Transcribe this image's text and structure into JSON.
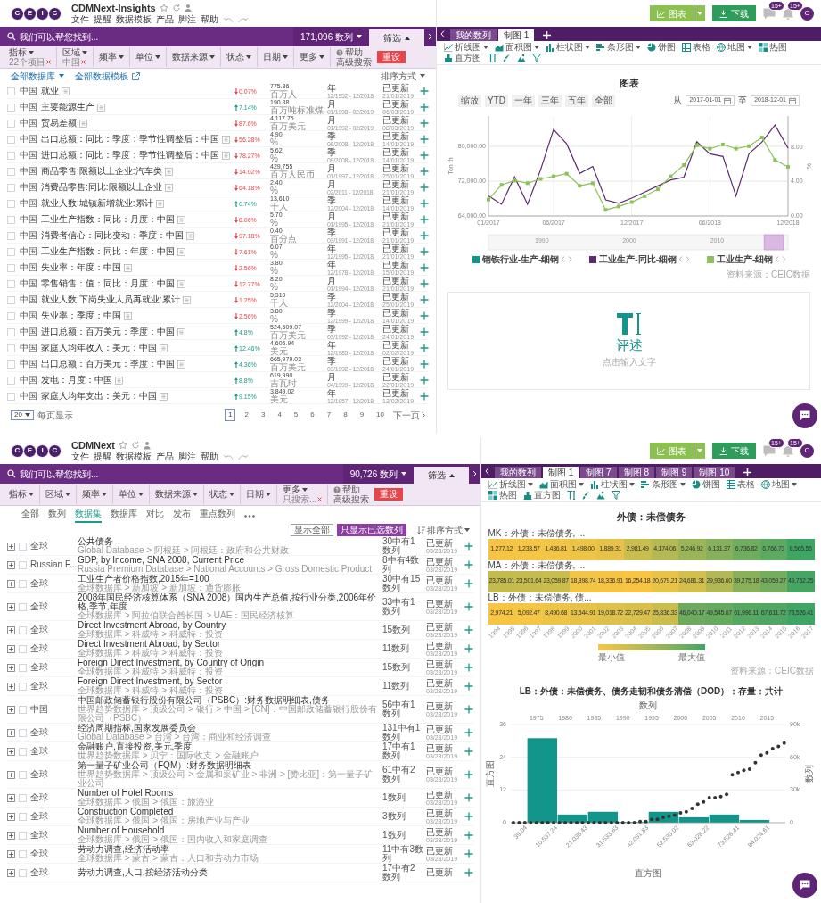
{
  "screens": [
    {
      "kind": "series",
      "app": {
        "logo": [
          "C",
          "E",
          "I",
          "C"
        ],
        "title": "CDMNext-Insights",
        "menu": [
          "文件",
          "提醒",
          "数据模板",
          "产品",
          "脚注",
          "帮助"
        ]
      },
      "search": {
        "placeholder": "我们可以帮您找到...",
        "count": "171,096 数列",
        "filter_tab": "筛选"
      },
      "filters": [
        {
          "label": "指标",
          "value": "22个项目"
        },
        {
          "label": "区域",
          "value": "中国"
        },
        {
          "label": "频率"
        },
        {
          "label": "单位"
        },
        {
          "label": "数据来源"
        },
        {
          "label": "状态"
        },
        {
          "label": "日期"
        },
        {
          "label": "更多"
        }
      ],
      "help": "帮助",
      "advanced_search": "高级搜索",
      "reset": "重设",
      "list_toolbar": {
        "database": "全部数据库",
        "template": "全部数据模板",
        "sort": "排序方式"
      },
      "series": [
        {
          "checked": false,
          "region": "中国",
          "name": "就业",
          "up": false,
          "change": "0.07%",
          "value": "775.86",
          "unit": "百万人",
          "frequency": "年",
          "range": "12/1952 - 12/2018",
          "status": "已更新",
          "date": "21/01/2019"
        },
        {
          "checked": false,
          "region": "中国",
          "name": "主要能源生产",
          "up": true,
          "change": "7.14%",
          "value": "190.88",
          "unit": "百万吨标准煤",
          "frequency": "月",
          "range": "01/1998 - 02/2019",
          "status": "已更新",
          "date": "06/03/2019"
        },
        {
          "checked": false,
          "region": "中国",
          "name": "贸易差额",
          "up": false,
          "change": "87.6%",
          "value": "4,117.75",
          "unit": "百万美元",
          "frequency": "月",
          "range": "01/1992 - 02/2019",
          "status": "已更新",
          "date": "08/03/2019"
        },
        {
          "checked": false,
          "region": "中国",
          "name": "出口总额：同比：季度：季节性调整后：中国",
          "up": false,
          "change": "56.28%",
          "value": "4.90",
          "unit": "%",
          "frequency": "季",
          "range": "09/2008 - 12/2018",
          "status": "已更新",
          "date": "14/01/2019"
        },
        {
          "checked": false,
          "region": "中国",
          "name": "进口总额：同比：季度：季节性调整后：中国",
          "up": false,
          "change": "78.27%",
          "value": "5.62",
          "unit": "%",
          "frequency": "季",
          "range": "09/2008 - 12/2018",
          "status": "已更新",
          "date": "14/01/2019"
        },
        {
          "checked": false,
          "region": "中国",
          "name": "商品零售:限额以上企业:汽车类",
          "up": false,
          "change": "14.02%",
          "value": "429,755",
          "unit": "百万人民币",
          "frequency": "月",
          "range": "01/1997 - 12/2018",
          "status": "已更新",
          "date": "25/01/2019"
        },
        {
          "checked": false,
          "region": "中国",
          "name": "消费品零售:同比:限额以上企业",
          "up": false,
          "change": "64.18%",
          "value": "2.40",
          "unit": "%",
          "frequency": "月",
          "range": "02/2011 - 12/2018",
          "status": "已更新",
          "date": "21/01/2019"
        },
        {
          "checked": false,
          "region": "中国",
          "name": "就业人数:城镇新增就业:累计",
          "up": true,
          "change": "0.74%",
          "value": "13,610",
          "unit": "千人",
          "frequency": "季",
          "range": "12/2004 - 12/2018",
          "status": "已更新",
          "date": "14/01/2019"
        },
        {
          "checked": false,
          "region": "中国",
          "name": "工业生产指数：同比：月度：中国",
          "up": false,
          "change": "8.06%",
          "value": "5.70",
          "unit": "%",
          "frequency": "月",
          "range": "01/1995 - 12/2018",
          "status": "已更新",
          "date": "21/01/2019"
        },
        {
          "checked": false,
          "region": "中国",
          "name": "消费者信心：同比变动：季度：中国",
          "up": false,
          "change": "97.18%",
          "value": "0.40",
          "unit": "百分点",
          "frequency": "季",
          "range": "03/1991 - 12/2018",
          "status": "已更新",
          "date": "21/01/2019"
        },
        {
          "checked": false,
          "region": "中国",
          "name": "工业生产指数：同比：年度：中国",
          "up": false,
          "change": "7.61%",
          "value": "6.07",
          "unit": "%",
          "frequency": "年",
          "range": "12/1995 - 12/2018",
          "status": "已更新",
          "date": "21/01/2019"
        },
        {
          "checked": false,
          "region": "中国",
          "name": "失业率：年度：中国",
          "up": false,
          "change": "2.56%",
          "value": "3.80",
          "unit": "%",
          "frequency": "年",
          "range": "12/1978 - 12/2018",
          "status": "已更新",
          "date": "15/01/2019"
        },
        {
          "checked": false,
          "region": "中国",
          "name": "零售销售：值：同比：月度：中国",
          "up": false,
          "change": "12.77%",
          "value": "8.20",
          "unit": "%",
          "frequency": "月",
          "range": "01/1994 - 12/2018",
          "status": "已更新",
          "date": "21/01/2019"
        },
        {
          "checked": false,
          "region": "中国",
          "name": "就业人数:下岗失业人员再就业:累计",
          "up": false,
          "change": "1.25%",
          "value": "5,510",
          "unit": "千人",
          "frequency": "季",
          "range": "12/2004 - 12/2018",
          "status": "已更新",
          "date": "25/01/2019"
        },
        {
          "checked": false,
          "region": "中国",
          "name": "失业率：季度：中国",
          "up": false,
          "change": "2.56%",
          "value": "3.80",
          "unit": "%",
          "frequency": "季",
          "range": "12/1999 - 12/2018",
          "status": "已更新",
          "date": "14/01/2019"
        },
        {
          "checked": false,
          "region": "中国",
          "name": "进口总额：百万美元：季度：中国",
          "up": true,
          "change": "4.8%",
          "value": "524,509.07",
          "unit": "百万美元",
          "frequency": "季",
          "range": "03/1992 - 12/2018",
          "status": "已更新",
          "date": "24/01/2019"
        },
        {
          "checked": false,
          "region": "中国",
          "name": "家庭人均年收入：美元：中国",
          "up": true,
          "change": "12.46%",
          "value": "4,605.94",
          "unit": "美元",
          "frequency": "年",
          "range": "12/1985 - 12/2018",
          "status": "已更新",
          "date": "02/02/2019"
        },
        {
          "checked": false,
          "region": "中国",
          "name": "出口总额：百万美元：季度：中国",
          "up": true,
          "change": "4.36%",
          "value": "665,979.03",
          "unit": "百万美元",
          "frequency": "季",
          "range": "03/1992 - 12/2018",
          "status": "已更新",
          "date": "24/01/2019"
        },
        {
          "checked": false,
          "region": "中国",
          "name": "发电：月度：中国",
          "up": true,
          "change": "8.8%",
          "value": "619,990",
          "unit": "吉瓦时",
          "frequency": "月",
          "range": "04/1999 - 12/2018",
          "status": "已更新",
          "date": "22/01/2019"
        },
        {
          "checked": false,
          "region": "中国",
          "name": "家庭人均年支出：美元：中国",
          "up": true,
          "change": "9.15%",
          "value": "3,849.02",
          "unit": "美元",
          "frequency": "年",
          "range": "12/1957 - 12/2018",
          "status": "已更新",
          "date": "13/02/2019"
        }
      ],
      "page_size": "20",
      "page_size_label": "每页显示",
      "pages": [
        {
          "label": "1",
          "selected": true
        },
        {
          "label": "2",
          "selected": false
        },
        {
          "label": "3",
          "selected": false
        },
        {
          "label": "4",
          "selected": false
        },
        {
          "label": "5",
          "selected": false
        },
        {
          "label": "6",
          "selected": false
        },
        {
          "label": "7",
          "selected": false
        },
        {
          "label": "8",
          "selected": false
        },
        {
          "label": "9",
          "selected": false
        },
        {
          "label": "10",
          "selected": false
        }
      ],
      "next_page": "下一页",
      "right": {
        "chart_button": "图表",
        "download_button": "下载",
        "message_badge": "15+",
        "alert_badge": "15+",
        "avatar": "C",
        "tabs": [
          {
            "label": "我的数列",
            "selected": false
          },
          {
            "label": "制图 1",
            "selected": true
          }
        ],
        "chart_types": [
          {
            "kind": "line",
            "label": "折线图",
            "dropdown": true
          },
          {
            "kind": "area",
            "label": "面积图",
            "dropdown": true
          },
          {
            "kind": "column",
            "label": "柱状图",
            "dropdown": true
          },
          {
            "kind": "bar",
            "label": "条形图",
            "dropdown": true
          },
          {
            "kind": "pie",
            "label": "饼图",
            "dropdown": false
          },
          {
            "kind": "table",
            "label": "表格",
            "dropdown": false
          },
          {
            "kind": "map",
            "label": "地图",
            "dropdown": true
          },
          {
            "kind": "heatmap",
            "label": "热图",
            "dropdown": false
          },
          {
            "kind": "histogram",
            "label": "直方图",
            "dropdown": false
          }
        ],
        "panels": [
          {
            "kind": "line_chart",
            "range_buttons": [
              "缩放",
              "YTD",
              "一年",
              "三年",
              "五年",
              "全部"
            ],
            "from_label": "从",
            "from": "2017-01-01",
            "to_label": "至",
            "to": "2018-12-01",
            "navigator": [
              "1990",
              "2000",
              "2010"
            ],
            "source": "资料来源：CEIC数据",
            "chart_data": {
              "type": "line",
              "title": "图表",
              "ylabel": "Ton th",
              "y2label": "%",
              "grid": true,
              "categories": [
                "01/2017",
                null,
                null,
                null,
                null,
                "06/2017",
                null,
                null,
                null,
                null,
                null,
                "12/2017",
                null,
                null,
                null,
                null,
                null,
                "06/2018",
                null,
                null,
                null,
                null,
                null,
                "12/2018"
              ],
              "ylim": [
                64000,
                87000
              ],
              "yticks": [
                {
                  "value": 64000,
                  "label": "64,000.00"
                },
                {
                  "value": 72000,
                  "label": "72,000.00"
                },
                {
                  "value": 80000,
                  "label": "80,000.00"
                }
              ],
              "y2lim": [
                0,
                11.6
              ],
              "y2ticks": [
                {
                  "value": 0,
                  "label": "0.00"
                },
                {
                  "value": 4,
                  "label": "4.00"
                },
                {
                  "value": 8,
                  "label": "8.00"
                }
              ],
              "series": [
                {
                  "name": "钢铁行业-生产-细钢",
                  "color": "#12968c",
                  "values": [
                    null,
                    null,
                    null,
                    null,
                    null,
                    null,
                    null,
                    null,
                    null,
                    null,
                    null,
                    null,
                    null,
                    null,
                    null,
                    null,
                    null,
                    null,
                    null,
                    null,
                    null,
                    null,
                    null,
                    null
                  ]
                },
                {
                  "name": "工业生产-同比-细钢",
                  "color": "#5d2a6e",
                  "values": [
                    68600,
                    66700,
                    73000,
                    66700,
                    74600,
                    83900,
                    80600,
                    73800,
                    75400,
                    67700,
                    66900,
                    68100,
                    69500,
                    70900,
                    72300,
                    72900,
                    81100,
                    78300,
                    77700,
                    68600,
                    78300,
                    81000,
                    84900,
                    79600
                  ]
                },
                {
                  "name": "工业生产-细钢",
                  "color": "#8dc25a",
                  "axis": "y2",
                  "marker": "square",
                  "values": [
                    1.9,
                    3.6,
                    4.1,
                    3.8,
                    4.3,
                    4.6,
                    4.9,
                    3.5,
                    3.8,
                    0.7,
                    1.1,
                    1.6,
                    2.3,
                    3.1,
                    4.6,
                    5.9,
                    8.2,
                    7.8,
                    8.3,
                    7.8,
                    8.1,
                    9.1,
                    6.5,
                    5.7
                  ]
                }
              ]
            }
          },
          {
            "kind": "commentary",
            "title": "评述",
            "hint": "点击输入文字"
          }
        ]
      }
    },
    {
      "kind": "datasets",
      "app": {
        "logo": [
          "C",
          "E",
          "I",
          "C"
        ],
        "title": "CDMNext",
        "menu": [
          "文件",
          "提醒",
          "数据模板",
          "产品",
          "脚注",
          "帮助"
        ]
      },
      "search": {
        "placeholder": "我们可以帮您找到...",
        "count": "90,726 数列",
        "filter_tab": "筛选"
      },
      "filters": [
        {
          "label": "指标"
        },
        {
          "label": "区域"
        },
        {
          "label": "频率"
        },
        {
          "label": "单位"
        },
        {
          "label": "数据来源"
        },
        {
          "label": "状态"
        },
        {
          "label": "日期"
        },
        {
          "label": "更多",
          "value": "只搜索..."
        }
      ],
      "help": "帮助",
      "advanced_search": "高级搜索",
      "reset": "重设",
      "result_tabs": [
        {
          "label": "全部",
          "selected": false
        },
        {
          "label": "数列",
          "selected": false
        },
        {
          "label": "数据集",
          "selected": true
        },
        {
          "label": "数据库",
          "selected": false
        },
        {
          "label": "对比",
          "selected": false
        },
        {
          "label": "发布",
          "selected": false
        },
        {
          "label": "重点数列",
          "selected": false
        }
      ],
      "toggles": [
        {
          "label": "显示全部",
          "selected": false
        },
        {
          "label": "只显示已选数列",
          "selected": true
        }
      ],
      "sort": "排序方式",
      "datasets": [
        {
          "checked": false,
          "region": "全球",
          "title": "公共债务",
          "path": "Global Database > 阿根廷 > 阿根廷：政府和公共财政",
          "count": "30中有1数列",
          "status": "已更新",
          "date": "03/28/2019"
        },
        {
          "checked": false,
          "region": "Russian F...",
          "title": "GDP, by Income, SNA 2008, Current Price",
          "path": "Russia Premium Database > National Accounts > Gross Domestic Product",
          "count": "8中有4数列",
          "status": "已更新",
          "date": "03/28/2019"
        },
        {
          "checked": false,
          "region": "全球",
          "title": "工业生产者价格指数,2015年=100",
          "path": "全球数据库 > 新加坡 > 新加坡：通货膨胀",
          "count": "30中有15数列",
          "status": "已更新",
          "date": "03/28/2019"
        },
        {
          "checked": false,
          "region": "全球",
          "title": "2008年国民经济核算体系（SNA 2008）国内生产总值,按行业分类,2006年价格,季节,年度",
          "path": "全球数据库 > 阿拉伯联合酋长国 > UAE：国民经济核算",
          "count": "33中有1数列",
          "status": "已更新",
          "date": "03/28/2019"
        },
        {
          "checked": false,
          "region": "全球",
          "title": "Direct Investment Abroad, by Country",
          "path": "全球数据库 > 科威特 > 科威特：投资",
          "count": "15数列",
          "status": "已更新",
          "date": "03/28/2019"
        },
        {
          "checked": false,
          "region": "全球",
          "title": "Direct Investment Abroad, by Sector",
          "path": "全球数据库 > 科威特 > 科威特：投资",
          "count": "11数列",
          "status": "已更新",
          "date": "03/28/2019"
        },
        {
          "checked": false,
          "region": "全球",
          "title": "Foreign Direct Investment, by Country of Origin",
          "path": "全球数据库 > 科威特 > 科威特：投资",
          "count": "15数列",
          "status": "已更新",
          "date": "03/28/2019"
        },
        {
          "checked": false,
          "region": "全球",
          "title": "Foreign Direct Investment, by Sector",
          "path": "全球数据库 > 科威特 > 科威特：投资",
          "count": "11数列",
          "status": "已更新",
          "date": "03/28/2019"
        },
        {
          "checked": false,
          "region": "中国",
          "title": "中国邮政储蓄银行股份有限公司（PSBC）:财务数据明细表,债务",
          "path": "世界趋势数据库 > 顶级公司 > 银行 > 中国 > [CN]：中国邮政储蓄银行股份有限公司（PSBC）",
          "count": "56中有1数列",
          "status": "已更新",
          "date": "03/28/2019"
        },
        {
          "checked": false,
          "region": "全球",
          "title": "经济周期指标,国家发展委员会",
          "path": "Global Database > 台湾 > 台湾：商业和经济调查",
          "count": "131中有1数列",
          "status": "已更新",
          "date": "03/28/2019"
        },
        {
          "checked": false,
          "region": "全球",
          "title": "金融账户,直接投资,美元,季度",
          "path": "世界趋势数据库 > 贝宁：国际收支 > 金融账户",
          "count": "17中有1数列",
          "status": "已更新",
          "date": "03/28/2019"
        },
        {
          "checked": false,
          "region": "全球",
          "title": "第一量子矿业公司（FQM）:财务数据明细表",
          "path": "世界趋势数据库 > 顶级公司 > 金属和采矿业 > 非洲 > [赞比亚]：第一量子矿业公司",
          "count": "61中有2数列",
          "status": "已更新",
          "date": "03/28/2019"
        },
        {
          "checked": false,
          "region": "全球",
          "title": "Number of Hotel Rooms",
          "path": "全球数据库 > 俄国 > 俄国：旅游业",
          "count": "1数列",
          "status": "已更新",
          "date": "03/28/2019"
        },
        {
          "checked": false,
          "region": "全球",
          "title": "Construction Completed",
          "path": "全球数据库 > 俄国 > 俄国：房地产业与产业",
          "count": "3数列",
          "status": "已更新",
          "date": "03/28/2019"
        },
        {
          "checked": false,
          "region": "全球",
          "title": "Number of Household",
          "path": "全球数据库 > 俄国 > 俄国：国内收入和家庭调查",
          "count": "1数列",
          "status": "已更新",
          "date": "03/28/2019"
        },
        {
          "checked": false,
          "region": "全球",
          "title": "劳动力调查,经济活动率",
          "path": "全球数据库 > 蒙古 > 蒙古：人口和劳动力市场",
          "count": "11中有3数列",
          "status": "已更新",
          "date": "03/28/2019"
        },
        {
          "checked": false,
          "region": "全球",
          "title": "劳动力调查,人口,按经济活动分类",
          "count": "17中有2数列",
          "status": "已更新"
        }
      ],
      "right": {
        "chart_button": "图表",
        "download_button": "下载",
        "message_badge": "15+",
        "alert_badge": "15+",
        "avatar": "C",
        "tabs": [
          {
            "label": "我的数列",
            "selected": false
          },
          {
            "label": "制图 1",
            "selected": true
          },
          {
            "label": "制图 7",
            "selected": false
          },
          {
            "label": "制图 8",
            "selected": false
          },
          {
            "label": "制图 9",
            "selected": false
          },
          {
            "label": "制图 10",
            "selected": false
          }
        ],
        "chart_types": [
          {
            "kind": "line",
            "label": "折线图",
            "dropdown": true
          },
          {
            "kind": "area",
            "label": "面积图",
            "dropdown": true
          },
          {
            "kind": "column",
            "label": "柱状图",
            "dropdown": true
          },
          {
            "kind": "bar",
            "label": "条形图",
            "dropdown": true
          },
          {
            "kind": "pie",
            "label": "饼图",
            "dropdown": false
          },
          {
            "kind": "table",
            "label": "表格",
            "dropdown": false
          },
          {
            "kind": "map",
            "label": "地图",
            "dropdown": true
          },
          {
            "kind": "heatmap",
            "label": "热图",
            "dropdown": false
          },
          {
            "kind": "histogram",
            "label": "直方图",
            "dropdown": false
          }
        ],
        "panels": [
          {
            "kind": "heatmap",
            "title": "外债：未偿债务",
            "rows": [
              {
                "label": "MK：外债：未偿债务, ...",
                "cells": [
                  {
                    "value": "1,277.12",
                    "color": "#f6c445"
                  },
                  {
                    "value": "1,233.57",
                    "color": "#f5c545"
                  },
                  {
                    "value": "1,436.81",
                    "color": "#f2c546"
                  },
                  {
                    "value": "1,498.00",
                    "color": "#eec447"
                  },
                  {
                    "value": "1,889.31",
                    "color": "#e6c348"
                  },
                  {
                    "value": "2,981.49",
                    "color": "#c9bd4e"
                  },
                  {
                    "value": "4,174.06",
                    "color": "#b4b953"
                  },
                  {
                    "value": "5,246.92",
                    "color": "#9ab558"
                  },
                  {
                    "value": "6,131.37",
                    "color": "#86b05b"
                  },
                  {
                    "value": "6,736.82",
                    "color": "#6fac5e"
                  },
                  {
                    "value": "6,766.73",
                    "color": "#5ca962"
                  },
                  {
                    "value": "8,565.55",
                    "color": "#3fa565"
                  }
                ]
              },
              {
                "label": "MA：外债：未偿债务, ...",
                "cells": [
                  {
                    "value": "23,785.01",
                    "color": "#c4bb4f"
                  },
                  {
                    "value": "23,501.64",
                    "color": "#c6bb4f"
                  },
                  {
                    "value": "23,059.87",
                    "color": "#c9bd4e"
                  },
                  {
                    "value": "18,898.74",
                    "color": "#f2c546"
                  },
                  {
                    "value": "18,336.91",
                    "color": "#f6c445"
                  },
                  {
                    "value": "16,254.18",
                    "color": "#f7c444"
                  },
                  {
                    "value": "20,679.21",
                    "color": "#e7c348"
                  },
                  {
                    "value": "24,681.31",
                    "color": "#d2bf4c"
                  },
                  {
                    "value": "29,936.60",
                    "color": "#b2b853"
                  },
                  {
                    "value": "39,275.18",
                    "color": "#8ab15a"
                  },
                  {
                    "value": "43,059.27",
                    "color": "#75ad5e"
                  },
                  {
                    "value": "49,752.25",
                    "color": "#45a664"
                  }
                ]
              },
              {
                "label": "LB：外债：未偿债务, 债...",
                "cells": [
                  {
                    "value": "2,974.21",
                    "color": "#f7c444"
                  },
                  {
                    "value": "5,092.47",
                    "color": "#f5c545"
                  },
                  {
                    "value": "8,490.68",
                    "color": "#eec447"
                  },
                  {
                    "value": "13,544.91",
                    "color": "#e6c348"
                  },
                  {
                    "value": "19,018.72",
                    "color": "#ddc14a"
                  },
                  {
                    "value": "22,729.47",
                    "color": "#d7c04b"
                  },
                  {
                    "value": "25,836.33",
                    "color": "#c9bd4e"
                  },
                  {
                    "value": "46,040.17",
                    "color": "#6cab5f"
                  },
                  {
                    "value": "49,545.67",
                    "color": "#66aa60"
                  },
                  {
                    "value": "61,996.11",
                    "color": "#55a862"
                  },
                  {
                    "value": "67,611.72",
                    "color": "#4fa763"
                  },
                  {
                    "value": "73,526.41",
                    "color": "#3fa565"
                  }
                ]
              }
            ],
            "years": [
              "1994",
              "1995",
              "1996",
              "1997",
              "1998",
              "1999",
              "2000",
              "2001",
              "2002",
              "2003",
              "2004",
              "2005",
              "2006",
              "2007",
              "2008",
              "2009",
              "2010",
              "2011",
              "2012",
              "2013",
              "2014",
              "2015",
              "2016",
              "2017"
            ],
            "legend_min": "最小值",
            "legend_max": "最大值",
            "source": "资料来源：CEIC数据"
          },
          {
            "kind": "histogram",
            "chart_data": {
              "type": "bar",
              "title": "LB：外债：未偿债务、债务走韧和债务清偿（DOD）：存量：共计",
              "xlabel": "直方图",
              "ylabel": "直方图",
              "x": [
                5288.14,
                15786.34,
                26284.53,
                36782.73,
                47280.93,
                57779.12,
                68277.32,
                78775.51
              ],
              "xlim": [
                -5700,
                89350
              ],
              "ylim": [
                0,
                36
              ],
              "yticks": [
                0,
                12,
                24,
                36
              ],
              "xticks": [
                {
                  "value": 39.04,
                  "label": "39.04"
                },
                {
                  "value": 10537.24,
                  "label": "10,537.24"
                },
                {
                  "value": 21035.43,
                  "label": "21,035.43"
                },
                {
                  "value": 31533.63,
                  "label": "31,533.63"
                },
                {
                  "value": 42031.83,
                  "label": "42,031.83"
                },
                {
                  "value": 52530.02,
                  "label": "52,530.02"
                },
                {
                  "value": 63028.22,
                  "label": "63,028.22"
                },
                {
                  "value": 73526.41,
                  "label": "73,526.41"
                },
                {
                  "value": 84024.61,
                  "label": "84,024.61"
                }
              ],
              "series": [
                {
                  "color": "#12968c",
                  "values": [
                    31,
                    3,
                    4,
                    0,
                    4,
                    2,
                    3,
                    1
                  ]
                }
              ]
            },
            "overlay": {
              "chart_data": {
                "type": "scatter",
                "xlabel": "数列",
                "ylabel": "数列",
                "x": [
                  1971,
                  1972,
                  1973,
                  1974,
                  1975,
                  1976,
                  1977,
                  1978,
                  1979,
                  1980,
                  1981,
                  1982,
                  1983,
                  1984,
                  1985,
                  1986,
                  1987,
                  1988,
                  1989,
                  1990,
                  1991,
                  1992,
                  1993,
                  1994,
                  1995,
                  1996,
                  1997,
                  1998,
                  1999,
                  2000,
                  2001,
                  2002,
                  2003,
                  2004,
                  2005,
                  2006,
                  2007,
                  2008,
                  2009,
                  2010,
                  2011,
                  2012,
                  2013,
                  2014,
                  2015,
                  2016,
                  2017,
                  2018
                ],
                "xlim": [
                  1970.55,
                  2018.2
                ],
                "ylim": [
                  0,
                  90000
                ],
                "xticks": [
                  1975,
                  1980,
                  1985,
                  1990,
                  1995,
                  2000,
                  2005,
                  2010,
                  2015
                ],
                "yticks": [
                  {
                    "value": 0,
                    "label": "0"
                  },
                  {
                    "value": 30000,
                    "label": "30k"
                  },
                  {
                    "value": 60000,
                    "label": "60k"
                  },
                  {
                    "value": 90000,
                    "label": "90k"
                  }
                ],
                "series": [
                  {
                    "color": "#333333",
                    "values": [
                      0,
                      0,
                      0,
                      0,
                      0,
                      0,
                      0,
                      0,
                      0,
                      0,
                      0,
                      0,
                      0,
                      0,
                      0,
                      0,
                      0,
                      0,
                      0,
                      0,
                      0,
                      0,
                      1000,
                      1000,
                      3000,
                      3000,
                      5000,
                      6000,
                      7000,
                      9000,
                      10000,
                      13000,
                      17000,
                      19000,
                      23000,
                      23000,
                      24000,
                      26000,
                      44000,
                      46000,
                      48000,
                      49000,
                      55000,
                      62000,
                      64000,
                      68000,
                      70000,
                      73000
                    ]
                  }
                ]
              }
            }
          }
        ]
      }
    }
  ]
}
